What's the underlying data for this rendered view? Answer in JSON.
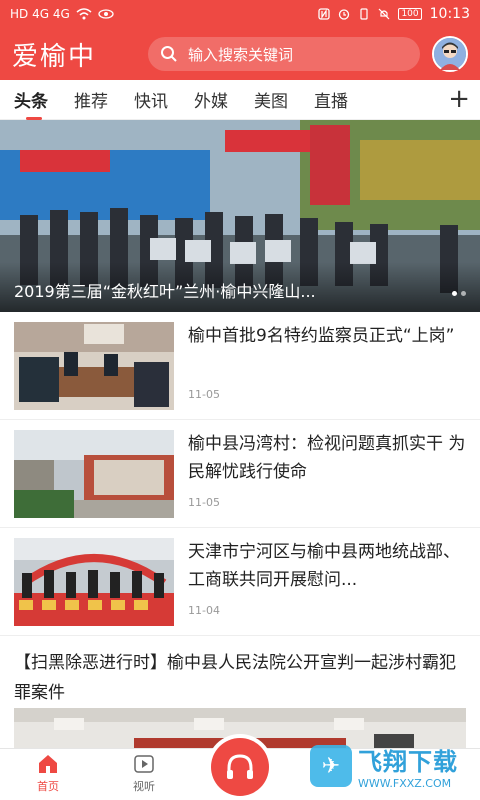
{
  "status_bar": {
    "left": "HD 4G 4G",
    "battery": "100",
    "time": "10:13"
  },
  "header": {
    "app_title": "爱榆中",
    "search_placeholder": "输入搜索关键词"
  },
  "tabs": [
    {
      "label": "头条",
      "active": true
    },
    {
      "label": "推荐",
      "active": false
    },
    {
      "label": "快讯",
      "active": false
    },
    {
      "label": "外媒",
      "active": false
    },
    {
      "label": "美图",
      "active": false
    },
    {
      "label": "直播",
      "active": false
    }
  ],
  "tabs_add": "+",
  "banner": {
    "caption": "2019第三届“金秋红叶”兰州·榆中兴隆山..."
  },
  "news": [
    {
      "title": "榆中首批9名特约监察员正式“上岗”",
      "date": "11-05"
    },
    {
      "title": "榆中县冯湾村：检视问题真抓实干 为民解忧践行使命",
      "date": "11-05"
    },
    {
      "title": "天津市宁河区与榆中县两地统战部、工商联共同开展慰问...",
      "date": "11-04"
    }
  ],
  "big_news": {
    "title": "【扫黑除恶进行时】榆中县人民法院公开宣判一起涉村霸犯罪案件"
  },
  "bottom_nav": [
    {
      "label": "首页",
      "icon": "home-icon",
      "active": true
    },
    {
      "label": "视听",
      "icon": "play-icon",
      "active": false
    }
  ],
  "watermark": {
    "brand": "飞翔下载",
    "url": "WWW.FXXZ.COM"
  },
  "colors": {
    "brand_red": "#ee4943"
  }
}
